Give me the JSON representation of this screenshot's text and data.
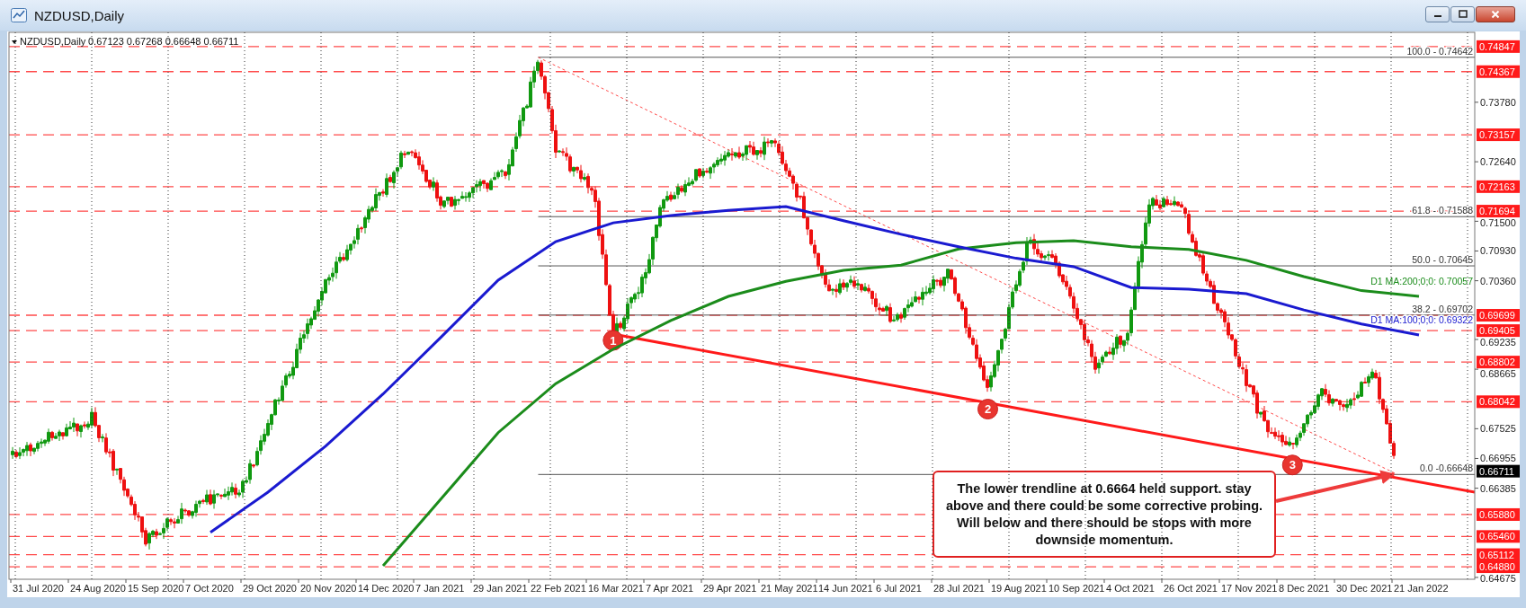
{
  "window": {
    "title": "NZDUSD,Daily"
  },
  "chart": {
    "header": {
      "symbol": "NZDUSD,Daily",
      "ohlc": "0.67123 0.67268 0.66648 0.66711"
    },
    "price_labels": [
      {
        "text": "0.74847",
        "kind": "level"
      },
      {
        "text": "0.74367",
        "kind": "level"
      },
      {
        "text": "0.73157",
        "kind": "level"
      },
      {
        "text": "0.72163",
        "kind": "level"
      },
      {
        "text": "0.71694",
        "kind": "level"
      },
      {
        "text": "0.69699",
        "kind": "level"
      },
      {
        "text": "0.69405",
        "kind": "level"
      },
      {
        "text": "0.68802",
        "kind": "level"
      },
      {
        "text": "0.68042",
        "kind": "level"
      },
      {
        "text": "0.66711",
        "kind": "current"
      },
      {
        "text": "0.65880",
        "kind": "level"
      },
      {
        "text": "0.65460",
        "kind": "level"
      },
      {
        "text": "0.65112",
        "kind": "level"
      },
      {
        "text": "0.64880",
        "kind": "level"
      }
    ],
    "fibonacci_levels": [
      {
        "label": "100.0 - 0.74642"
      },
      {
        "label": "61.8 - 0.71588"
      },
      {
        "label": "50.0 - 0.70645"
      },
      {
        "label": "38.2 - 0.69702"
      },
      {
        "label": "0.0 -0.66648"
      }
    ],
    "moving_averages": [
      {
        "label": "D1 MA:200;0;0: 0.70057"
      },
      {
        "label": "D1 MA:100;0;0: 0.69322"
      }
    ],
    "trendline_points": [
      "1",
      "2",
      "3"
    ],
    "annotation": "The lower trendline at 0.6664 held support. stay above and there could be some corrective probing. Will below and there should be stops with more downside momentum.",
    "chart_data": {
      "type": "line",
      "categories": [
        "31 Jul 2020",
        "24 Aug 2020",
        "15 Sep 2020",
        "7 Oct 2020",
        "29 Oct 2020",
        "20 Nov 2020",
        "14 Dec 2020",
        "7 Jan 2021",
        "29 Jan 2021",
        "22 Feb 2021",
        "16 Mar 2021",
        "7 Apr 2021",
        "29 Apr 2021",
        "21 May 2021",
        "14 Jun 2021",
        "6 Jul 2021",
        "28 Jul 2021",
        "19 Aug 2021",
        "10 Sep 2021",
        "4 Oct 2021",
        "26 Oct 2021",
        "17 Nov 2021",
        "8 Dec 2021",
        "30 Dec 2021",
        "21 Jan 2022"
      ],
      "series": [
        {
          "color": "#1b8c1b",
          "values": [
            null,
            null,
            null,
            null,
            null,
            null,
            0.649,
            0.6617,
            0.6745,
            0.6839,
            0.6905,
            0.696,
            0.7006,
            0.7035,
            0.7056,
            0.7066,
            0.7097,
            0.7109,
            0.7113,
            0.7101,
            0.7096,
            0.7075,
            0.7044,
            0.7017,
            0.7006
          ]
        },
        {
          "color": "#1a1ad0",
          "values": [
            null,
            null,
            null,
            0.6554,
            0.6631,
            0.6719,
            0.6819,
            0.6927,
            0.7037,
            0.7111,
            0.7147,
            0.7161,
            0.7171,
            0.7178,
            0.7151,
            0.7125,
            0.7101,
            0.7079,
            0.7063,
            0.7023,
            0.702,
            0.7011,
            0.698,
            0.6953,
            0.6932
          ]
        }
      ],
      "grid": true,
      "ylim": [
        0.6464,
        0.7512
      ],
      "yticks": [
        {
          "value": 0.7378,
          "label": "0.73780"
        },
        {
          "value": 0.7264,
          "label": "0.72640"
        },
        {
          "value": 0.715,
          "label": "0.71500"
        },
        {
          "value": 0.7093,
          "label": "0.70930"
        },
        {
          "value": 0.7036,
          "label": "0.70360"
        },
        {
          "value": 0.69235,
          "label": "0.69235"
        },
        {
          "value": 0.68665,
          "label": "0.68665"
        },
        {
          "value": 0.67525,
          "label": "0.67525"
        },
        {
          "value": 0.66955,
          "label": "0.66955"
        },
        {
          "value": 0.66385,
          "label": "0.66385"
        },
        {
          "value": 0.64675,
          "label": "0.64675"
        }
      ]
    }
  }
}
